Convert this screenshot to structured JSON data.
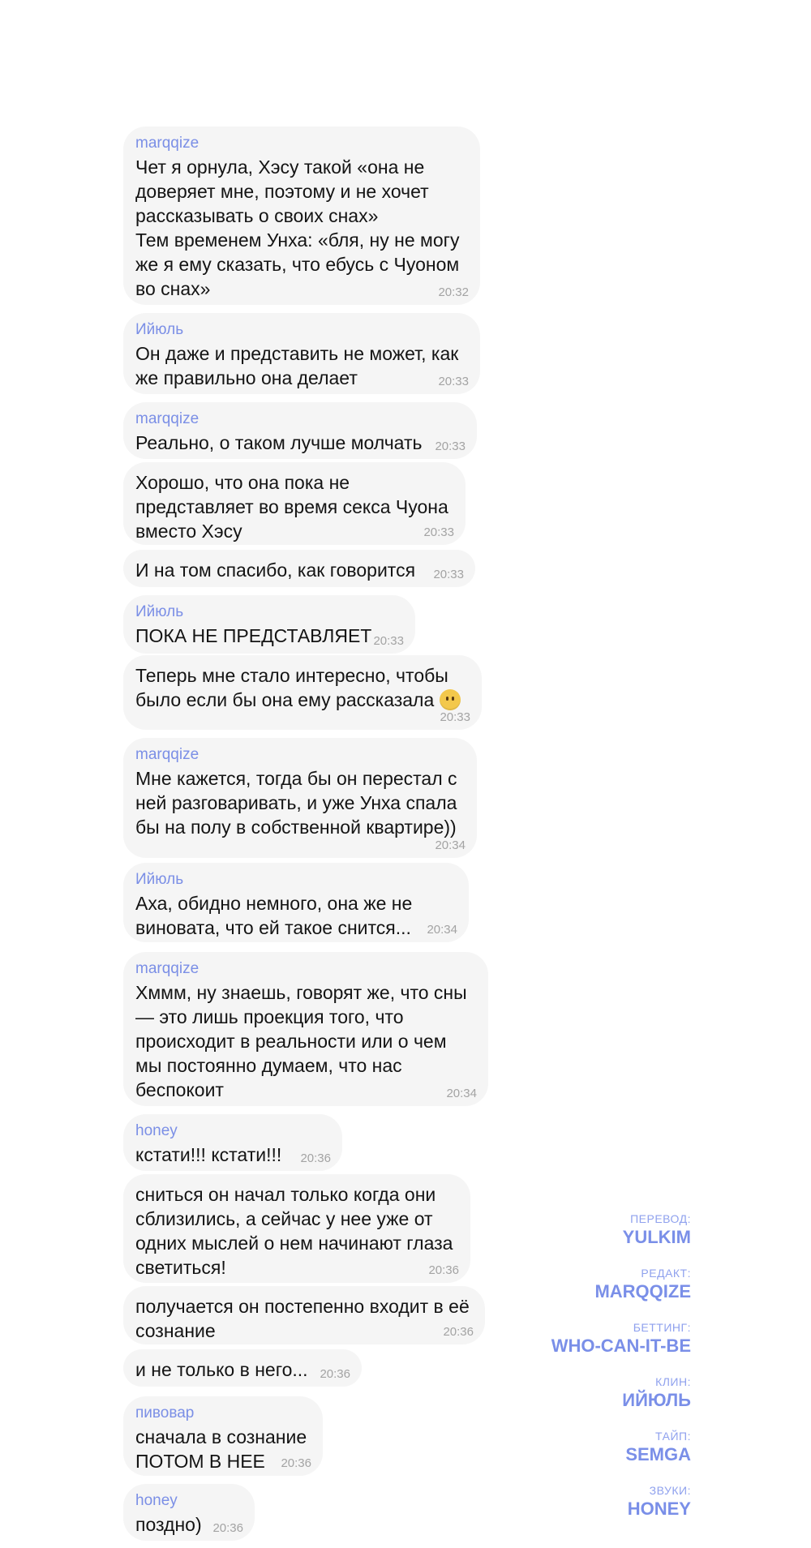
{
  "messages": [
    {
      "sender": "marqqize",
      "text": "Чет я орнула, Хэсу такой «она не\nдоверяет мне, поэтому и не хочет\nрассказывать о своих снах»\nТем временем Унха: «бля, ну не могу\nже я ему сказать, что ебусь с Чуоном\nво снах»",
      "time": "20:32"
    },
    {
      "sender": "Ийюль",
      "text": "Он даже и представить не может, как\nже правильно она делает",
      "time": "20:33"
    },
    {
      "sender": "marqqize",
      "text": "Реально, о таком лучше молчать",
      "time": "20:33"
    },
    {
      "sender": "",
      "text": "Хорошо, что она пока не\nпредставляет во время секса Чуона\nвместо Хэсу",
      "time": "20:33"
    },
    {
      "sender": "",
      "text": "И на том спасибо, как говорится",
      "time": "20:33"
    },
    {
      "sender": "Ийюль",
      "text": "ПОКА НЕ ПРЕДСТАВЛЯЕТ",
      "time": "20:33"
    },
    {
      "sender": "",
      "text": "Теперь мне стало интересно, чтобы\nбыло если бы она ему рассказала",
      "time": "20:33",
      "emoji": "face-without-mouth"
    },
    {
      "sender": "marqqize",
      "text": "Мне кажется, тогда бы он перестал с\nней разговаривать, и уже Унха спала\nбы на полу в собственной квартире))",
      "time": "20:34"
    },
    {
      "sender": "Ийюль",
      "text": "Аха, обидно немного, она же не\nвиновата, что ей такое снится...",
      "time": "20:34"
    },
    {
      "sender": "marqqize",
      "text": "Хммм, ну знаешь, говорят же, что сны\n— это лишь проекция того, что\nпроисходит в реальности или о чем\nмы постоянно думаем, что нас\nбеспокоит",
      "time": "20:34"
    },
    {
      "sender": "honey",
      "text": "кстати!!! кстати!!!",
      "time": "20:36"
    },
    {
      "sender": "",
      "text": "сниться он начал только когда они\nсблизились, а сейчас у нее уже от\nодних мыслей о нем начинают глаза\nсветиться!",
      "time": "20:36"
    },
    {
      "sender": "",
      "text": "получается он постепенно входит в её\nсознание",
      "time": "20:36"
    },
    {
      "sender": "",
      "text": "и не только в него...",
      "time": "20:36"
    },
    {
      "sender": "пивовар",
      "text": "сначала в сознание\nПОТОМ В НЕЕ",
      "time": "20:36"
    },
    {
      "sender": "honey",
      "text": "поздно)",
      "time": "20:36"
    }
  ],
  "credits": [
    {
      "role": "ПЕРЕВОД:",
      "name": "YULKIM"
    },
    {
      "role": "РЕДАКТ:",
      "name": "MARQQIZE"
    },
    {
      "role": "БЕТТИНГ:",
      "name": "WHO-CAN-IT-BE"
    },
    {
      "role": "КЛИН:",
      "name": "ИЙЮЛЬ"
    },
    {
      "role": "ТАЙП:",
      "name": "SEMGA"
    },
    {
      "role": "ЗВУКИ:",
      "name": "HONEY"
    }
  ],
  "colors": {
    "bubble": "#f5f5f5",
    "sender": "#7b8fe6",
    "text": "#141414",
    "time": "#a3a3a3",
    "credit_name": "#7a8fe8"
  }
}
